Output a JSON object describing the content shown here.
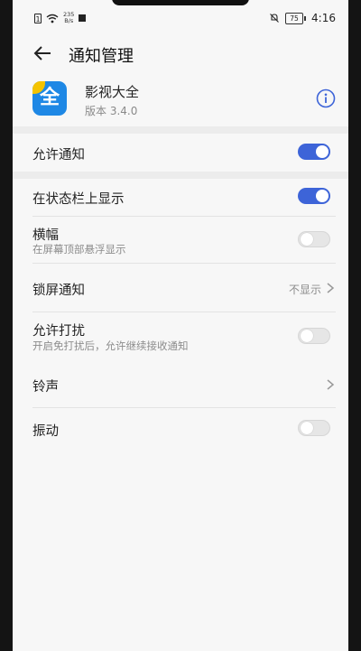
{
  "status_bar": {
    "speed": "235",
    "speed_unit": "B/s",
    "battery": "75",
    "time": "4:16"
  },
  "header": {
    "title": "通知管理"
  },
  "app": {
    "name": "影视大全",
    "version": "版本 3.4.0",
    "icon_glyph": "全"
  },
  "settings": {
    "allow_notifications": {
      "label": "允许通知",
      "enabled": true
    },
    "show_in_status_bar": {
      "label": "在状态栏上显示",
      "enabled": true
    },
    "banner": {
      "label": "横幅",
      "desc": "在屏幕顶部悬浮显示",
      "enabled": false
    },
    "lock_screen": {
      "label": "锁屏通知",
      "value": "不显示"
    },
    "allow_dnd": {
      "label": "允许打扰",
      "desc": "开启免打扰后，允许继续接收通知",
      "enabled": false
    },
    "ringtone": {
      "label": "铃声"
    },
    "vibration": {
      "label": "振动",
      "enabled": false
    }
  },
  "colors": {
    "accent": "#3d64d8",
    "app_icon_bg": "#1e88e5",
    "app_icon_corner": "#f4c300"
  },
  "icons": [
    "back-arrow-icon",
    "info-icon",
    "chevron-right-icon"
  ]
}
